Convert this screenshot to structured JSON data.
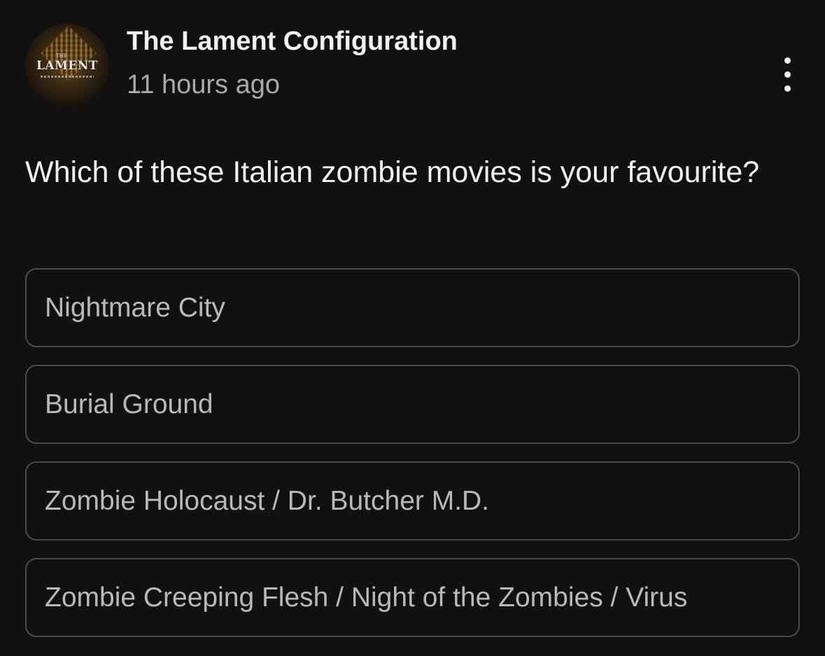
{
  "post": {
    "channel_name": "The Lament Configuration",
    "timestamp": "11 hours ago",
    "avatar_text": "LAMENT",
    "avatar_small_text": "THE",
    "menu_icon": "more-vertical-icon",
    "question": "Which of these Italian zombie movies is your favourite?",
    "options": [
      {
        "label": "Nightmare City"
      },
      {
        "label": "Burial Ground"
      },
      {
        "label": "Zombie Holocaust / Dr. Butcher M.D."
      },
      {
        "label": "Zombie Creeping Flesh / Night of the Zombies / Virus"
      }
    ]
  },
  "colors": {
    "background": "#111111",
    "primary_text": "#f1f1f1",
    "secondary_text": "#a9a9a9",
    "option_text": "#b9b9b9",
    "option_border": "#4a4a4a"
  }
}
